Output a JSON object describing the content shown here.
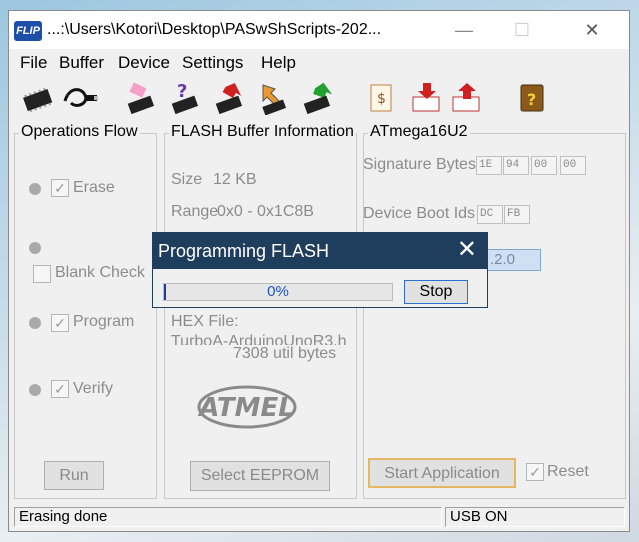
{
  "window": {
    "title": "...:\\Users\\Kotori\\Desktop\\PASwShScripts-202...",
    "logo_text": "FLIP",
    "minimize": "—",
    "maximize": "☐",
    "close": "✕"
  },
  "menu": [
    "File",
    "Buffer",
    "Device",
    "Settings",
    "Help"
  ],
  "toolbar": {
    "icons": [
      "chip-select-icon",
      "usb-connect-icon",
      "erase-chip-icon",
      "blank-check-icon",
      "program-chip-icon",
      "verify-chip-icon",
      "read-chip-icon",
      "edit-buffer-icon",
      "load-hex-icon",
      "save-hex-icon",
      "help-book-icon"
    ]
  },
  "operations": {
    "title": "Operations Flow",
    "erase_label": "Erase",
    "erase_checked": true,
    "blank_check_label": "Blank Check",
    "blank_check_checked": false,
    "program_label": "Program",
    "program_checked": true,
    "verify_label": "Verify",
    "verify_checked": true,
    "run_label": "Run"
  },
  "flash_buffer": {
    "title": "FLASH Buffer Information",
    "size_label": "Size",
    "size_value": "12 KB",
    "range_label": "Range",
    "range_value": "0x0 - 0x1C8B",
    "hex_file_label": "HEX File:",
    "hex_file_value": "TurboA-ArduinoUnoR3.h",
    "util_bytes": "7308 util bytes",
    "select_eeprom_label": "Select EEPROM",
    "atmel_logo_text": "ATMEL"
  },
  "device": {
    "title": "ATmega16U2",
    "signature_label": "Signature Bytes",
    "signature_bytes": [
      "1E",
      "94",
      "00",
      "00"
    ],
    "boot_ids_label": "Device Boot Ids",
    "boot_ids": [
      "DC",
      "FB"
    ],
    "version_value": ".2.0",
    "start_app_label": "Start Application",
    "reset_label": "Reset",
    "reset_checked": true
  },
  "status": {
    "left": "Erasing done",
    "right": "USB ON"
  },
  "dialog": {
    "title": "Programming FLASH",
    "close": "✕",
    "progress_text": "0%",
    "progress_fraction": 0.01,
    "stop_label": "Stop"
  },
  "colors": {
    "dialog_title_bg": "#1f3d5c",
    "progress_fill": "#1b3fa0",
    "stop_border": "#2a6fd4",
    "start_app_border": "#e3b860"
  }
}
